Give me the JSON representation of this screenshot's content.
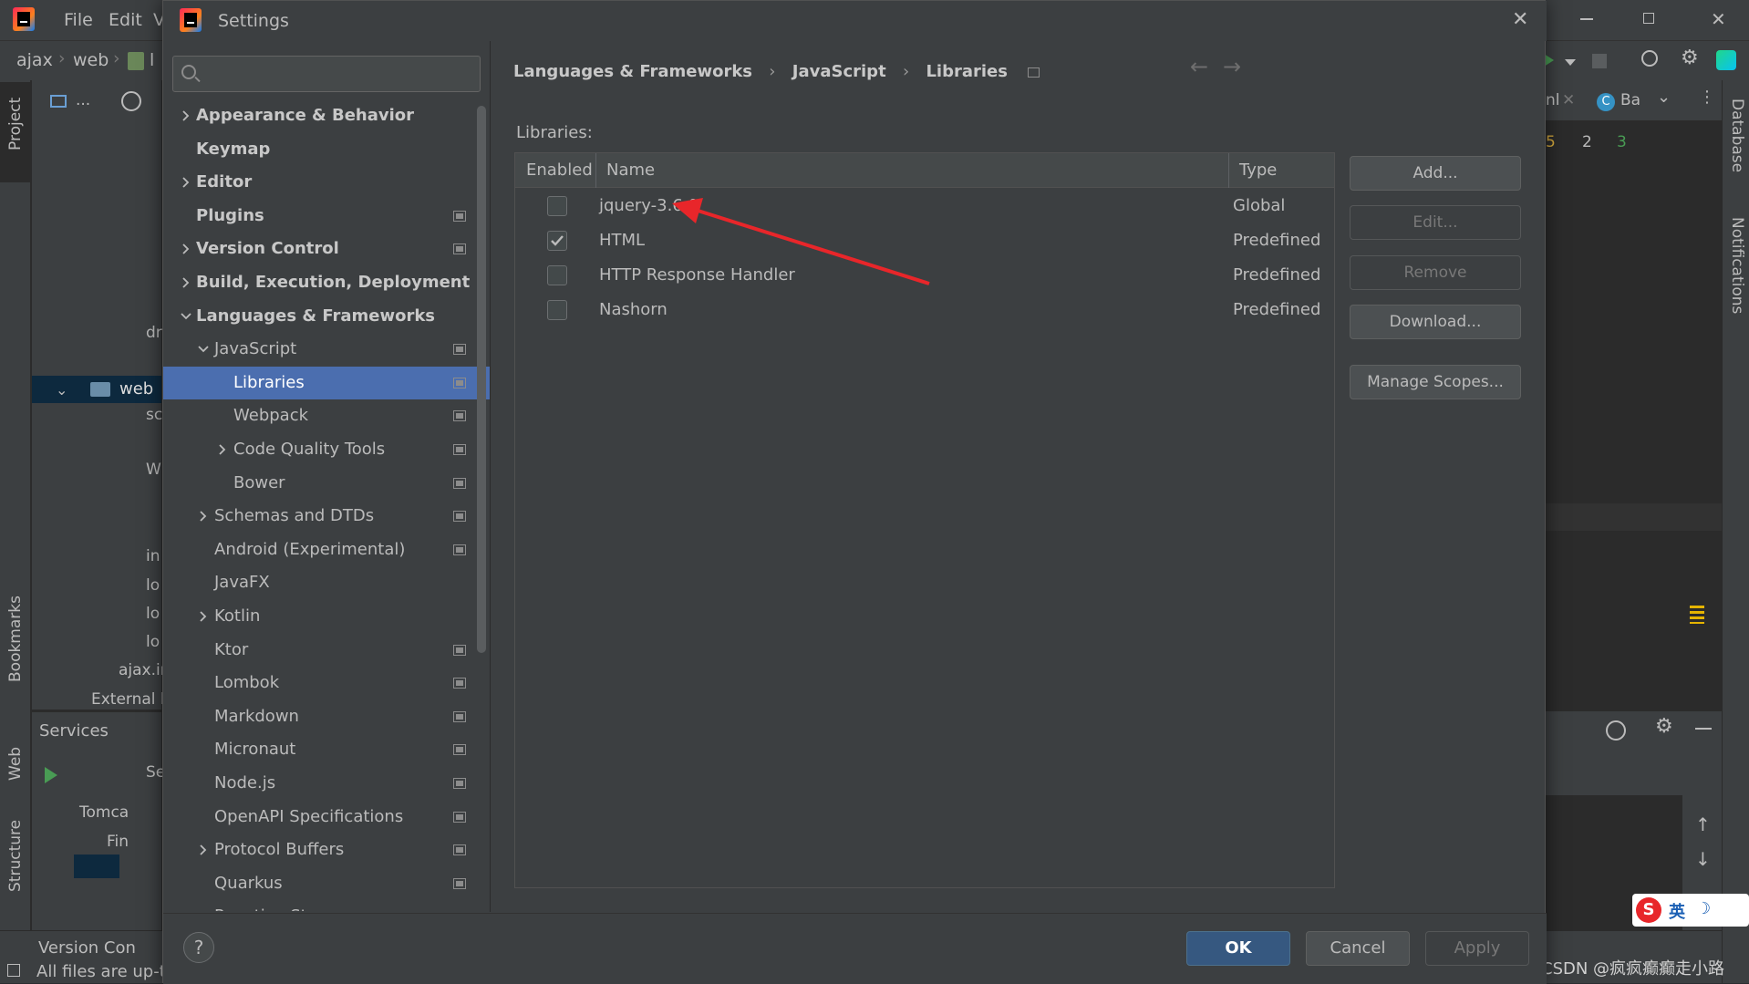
{
  "ide": {
    "menu": [
      "File",
      "Edit",
      "V"
    ],
    "nav": {
      "project": "ajax",
      "folder": "web",
      "file_short": "l"
    },
    "left_tabs": [
      "Project",
      "Bookmarks",
      "Web",
      "Structure"
    ],
    "right_tabs": [
      "Database",
      "Notifications"
    ],
    "tree_rows": [
      "...",
      "dr",
      "web",
      "sc",
      "W",
      "in",
      "lo",
      "lo",
      "lo",
      "ajax.ir",
      "External l"
    ],
    "services": {
      "title": "Services",
      "item1": "Tomca",
      "item2": "Fin",
      "tab": "Se"
    },
    "version_control": "Version Con",
    "status": "All files are up-to",
    "editor_tab": "Ba",
    "editor_tab_left": "nl",
    "inspections": {
      "warnings": "5",
      "weak": "2",
      "ok": "3"
    },
    "watermark": "CSDN @疯疯癫癫走小路",
    "ime": {
      "lang": "英"
    }
  },
  "dialog": {
    "title": "Settings",
    "search_placeholder": "",
    "breadcrumb": [
      "Languages & Frameworks",
      "JavaScript",
      "Libraries"
    ],
    "tree": [
      {
        "label": "Appearance & Behavior",
        "bold": true,
        "expand": "collapsed",
        "indent": 0,
        "proj": false
      },
      {
        "label": "Keymap",
        "bold": true,
        "expand": "none",
        "indent": 0,
        "proj": false
      },
      {
        "label": "Editor",
        "bold": true,
        "expand": "collapsed",
        "indent": 0,
        "proj": false
      },
      {
        "label": "Plugins",
        "bold": true,
        "expand": "none",
        "indent": 0,
        "proj": true
      },
      {
        "label": "Version Control",
        "bold": true,
        "expand": "collapsed",
        "indent": 0,
        "proj": true
      },
      {
        "label": "Build, Execution, Deployment",
        "bold": true,
        "expand": "collapsed",
        "indent": 0,
        "proj": false
      },
      {
        "label": "Languages & Frameworks",
        "bold": true,
        "expand": "expanded",
        "indent": 0,
        "proj": false
      },
      {
        "label": "JavaScript",
        "bold": false,
        "expand": "expanded",
        "indent": 1,
        "proj": true
      },
      {
        "label": "Libraries",
        "bold": false,
        "expand": "none",
        "indent": 2,
        "proj": true,
        "selected": true
      },
      {
        "label": "Webpack",
        "bold": false,
        "expand": "none",
        "indent": 2,
        "proj": true
      },
      {
        "label": "Code Quality Tools",
        "bold": false,
        "expand": "collapsed",
        "indent": 2,
        "proj": true
      },
      {
        "label": "Bower",
        "bold": false,
        "expand": "none",
        "indent": 2,
        "proj": true
      },
      {
        "label": "Schemas and DTDs",
        "bold": false,
        "expand": "collapsed",
        "indent": 1,
        "proj": true
      },
      {
        "label": "Android (Experimental)",
        "bold": false,
        "expand": "none",
        "indent": 1,
        "proj": true
      },
      {
        "label": "JavaFX",
        "bold": false,
        "expand": "none",
        "indent": 1,
        "proj": false
      },
      {
        "label": "Kotlin",
        "bold": false,
        "expand": "collapsed",
        "indent": 1,
        "proj": false
      },
      {
        "label": "Ktor",
        "bold": false,
        "expand": "none",
        "indent": 1,
        "proj": true
      },
      {
        "label": "Lombok",
        "bold": false,
        "expand": "none",
        "indent": 1,
        "proj": true
      },
      {
        "label": "Markdown",
        "bold": false,
        "expand": "none",
        "indent": 1,
        "proj": true
      },
      {
        "label": "Micronaut",
        "bold": false,
        "expand": "none",
        "indent": 1,
        "proj": true
      },
      {
        "label": "Node.js",
        "bold": false,
        "expand": "none",
        "indent": 1,
        "proj": true
      },
      {
        "label": "OpenAPI Specifications",
        "bold": false,
        "expand": "none",
        "indent": 1,
        "proj": true
      },
      {
        "label": "Protocol Buffers",
        "bold": false,
        "expand": "collapsed",
        "indent": 1,
        "proj": true
      },
      {
        "label": "Quarkus",
        "bold": false,
        "expand": "none",
        "indent": 1,
        "proj": true
      },
      {
        "label": "Reactive Streams",
        "bold": false,
        "expand": "none",
        "indent": 1,
        "proj": true
      }
    ],
    "libraries_label": "Libraries:",
    "table": {
      "headers": {
        "enabled": "Enabled",
        "name": "Name",
        "type": "Type"
      },
      "rows": [
        {
          "name": "jquery-3.6.0",
          "type": "Global",
          "enabled": false
        },
        {
          "name": "HTML",
          "type": "Predefined",
          "enabled": true
        },
        {
          "name": "HTTP Response Handler",
          "type": "Predefined",
          "enabled": false
        },
        {
          "name": "Nashorn",
          "type": "Predefined",
          "enabled": false
        }
      ]
    },
    "buttons": {
      "add": "Add...",
      "edit": "Edit...",
      "remove": "Remove",
      "download": "Download...",
      "manage_scopes": "Manage Scopes..."
    },
    "footer": {
      "help": "?",
      "ok": "OK",
      "cancel": "Cancel",
      "apply": "Apply"
    },
    "colors": {
      "accent": "#4b6eaf",
      "ok_button": "#365880",
      "annotation_arrow": "#e8262a"
    }
  }
}
